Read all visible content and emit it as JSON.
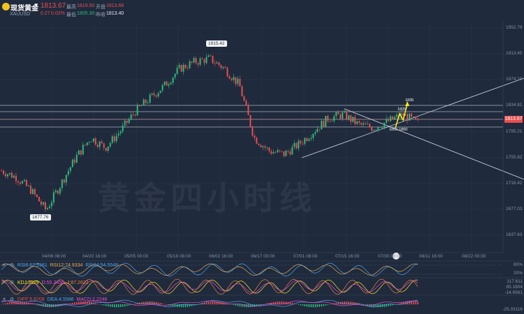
{
  "instrument": {
    "title": "现货黄金",
    "symbol": "XAUUSD",
    "last_price": "1813.67",
    "change": "0.27",
    "change_pct": "0.02%"
  },
  "quote": {
    "high_label": "最高",
    "high_value": "1819.50",
    "open_label": "开盘",
    "open_value": "1813.66",
    "low_label": "最低",
    "low_value": "1805.30",
    "prev_close_label": "昨收",
    "prev_close_value": "1813.40"
  },
  "price_axis": [
    "1952.79",
    "1913.45",
    "1874.10",
    "1834.81",
    "1795.21",
    "1755.82",
    "1716.42",
    "1677.03",
    "1637.63"
  ],
  "current_price_tag": "1813.67",
  "date_axis": [
    "04/06 08:00",
    "04/20 16:00",
    "05/05 00:00",
    "05/19 08:00",
    "06/02 16:00",
    "06/17 00:00",
    "07/01 08:00",
    "07/15 16:00",
    "07/30 00:00",
    "08/11 16:00",
    "08/22 00:00"
  ],
  "annotations": {
    "high": "1915.42",
    "low": "1677.76",
    "target_1835": "1835",
    "target_1825": "1825",
    "support_range": "1805-1800"
  },
  "watermark": "黄金四小时线",
  "indicators": {
    "rsi_label": "RSI6:62.5161",
    "rsi_values": [
      "RSI12:74.9334",
      "RSI24:54.5548"
    ],
    "rsi_axis": [
      "80%",
      "20%"
    ],
    "kdj_label": "KDJ:3929",
    "kdj_values": [
      "D:55.2456",
      "J:87.2632"
    ],
    "kdj_axis": [
      "117.611",
      "85.1804",
      "-14.6561"
    ],
    "macd_label": "DIFF:5.6709",
    "macd_values": [
      "DEA:4.5586",
      "MACD:2.2246"
    ],
    "macd_axis": [
      "-25.33116"
    ]
  },
  "colors": {
    "background": "#1f2a3d",
    "up": "#2fb97a",
    "down": "#e84e4e",
    "price_tag": "#e84e4e",
    "annotation": "#f5e61f"
  },
  "chart_data": {
    "type": "candlestick",
    "y_range": [
      1620,
      1965
    ],
    "x": [
      "04/06 08:00",
      "04/20 16:00",
      "05/05 00:00",
      "05/19 08:00",
      "06/02 16:00",
      "06/17 00:00",
      "07/01 08:00",
      "07/15 16:00",
      "07/30 00:00"
    ],
    "close_path": [
      1740,
      1730,
      1710,
      1680,
      1720,
      1760,
      1790,
      1775,
      1800,
      1830,
      1850,
      1870,
      1895,
      1905,
      1910,
      1895,
      1870,
      1790,
      1770,
      1765,
      1780,
      1800,
      1820,
      1825,
      1810,
      1805,
      1815,
      1825,
      1813
    ]
  }
}
